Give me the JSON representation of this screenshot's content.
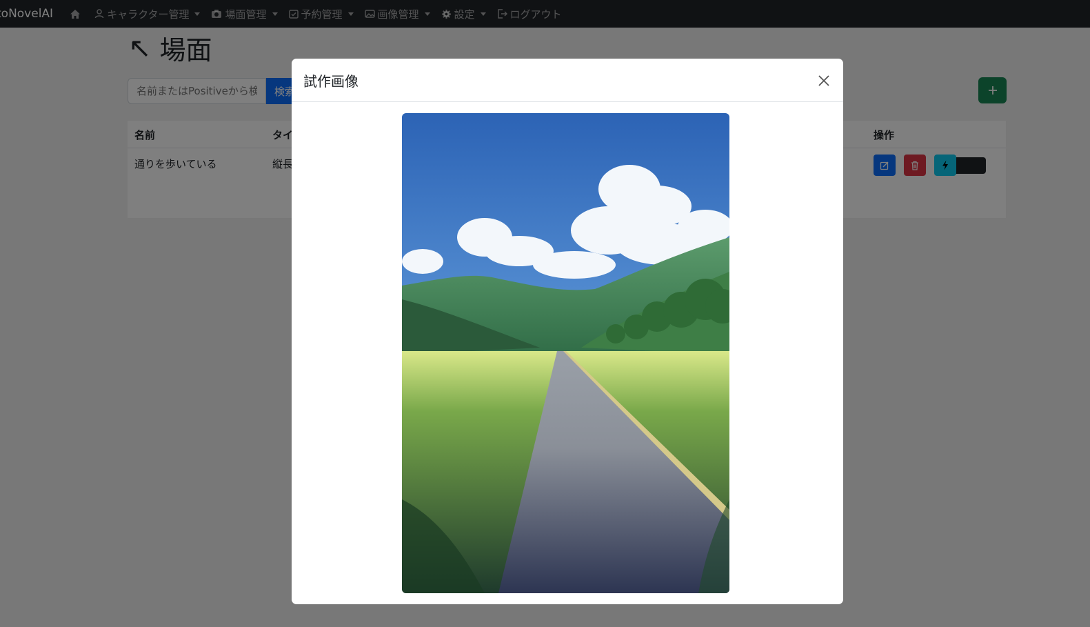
{
  "navbar": {
    "brand": "toNovelAI",
    "items": [
      {
        "label": "",
        "icon": "home-icon",
        "dropdown": false
      },
      {
        "label": "キャラクター管理",
        "icon": "user-icon",
        "dropdown": true
      },
      {
        "label": "場面管理",
        "icon": "camera-icon",
        "dropdown": true
      },
      {
        "label": "予約管理",
        "icon": "calendar-icon",
        "dropdown": true
      },
      {
        "label": "画像管理",
        "icon": "image-icon",
        "dropdown": true
      },
      {
        "label": "設定",
        "icon": "gear-icon",
        "dropdown": true
      },
      {
        "label": "ログアウト",
        "icon": "logout-icon",
        "dropdown": false
      }
    ]
  },
  "page": {
    "title": "場面",
    "title_icon": "arrow-up-left-icon",
    "search": {
      "placeholder": "名前またはPositiveから検索",
      "button_label": "検索"
    },
    "add_button_icon": "plus-icon"
  },
  "table": {
    "headers": {
      "name": "名前",
      "type": "タイ",
      "actions": "操作"
    },
    "rows": [
      {
        "name": "通りを歩いている",
        "type": "縦長"
      }
    ]
  },
  "modal": {
    "title": "試作画像",
    "close_icon": "close-icon",
    "image_subject": "anime-style landscape: country road through green fields, mountains, blue sky with clouds"
  },
  "colors": {
    "navbar_bg": "#212529",
    "primary": "#0d6efd",
    "danger": "#dc3545",
    "info": "#0dcaf0",
    "success": "#198754"
  }
}
